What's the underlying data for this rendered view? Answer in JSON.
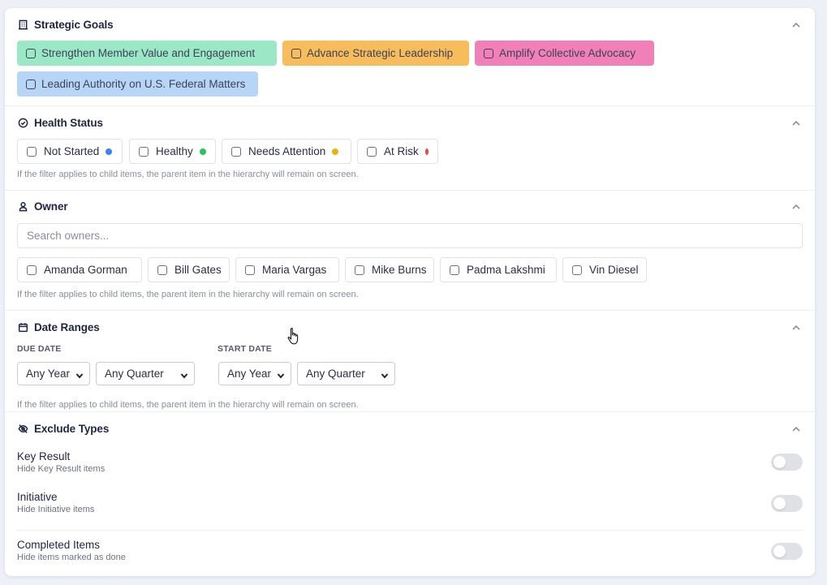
{
  "strategic_goals": {
    "title": "Strategic Goals",
    "icon": "building-icon",
    "goals": [
      {
        "label": "Strengthen Member Value and Engagement",
        "color": "#9be8c7"
      },
      {
        "label": "Advance Strategic Leadership",
        "color": "#f7bd5c"
      },
      {
        "label": "Amplify Collective Advocacy",
        "color": "#f17fb8"
      },
      {
        "label": "Leading Authority on U.S. Federal Matters",
        "color": "#b7d6f7"
      }
    ]
  },
  "health_status": {
    "title": "Health Status",
    "icon": "check-circle-icon",
    "options": [
      {
        "label": "Not Started",
        "color": "#3b82f6"
      },
      {
        "label": "Healthy",
        "color": "#22c55e"
      },
      {
        "label": "Needs Attention",
        "color": "#eab308"
      },
      {
        "label": "At Risk",
        "color": "#ef4444"
      }
    ],
    "hint": "If the filter applies to child items, the parent item in the hierarchy will remain on screen."
  },
  "owner": {
    "title": "Owner",
    "icon": "user-icon",
    "search_placeholder": "Search owners...",
    "owners": [
      "Amanda Gorman",
      "Bill Gates",
      "Maria Vargas",
      "Mike Burns",
      "Padma Lakshmi",
      "Vin Diesel"
    ],
    "hint": "If the filter applies to child items, the parent item in the hierarchy will remain on screen."
  },
  "date_ranges": {
    "title": "Date Ranges",
    "icon": "calendar-icon",
    "due_date_label": "DUE DATE",
    "start_date_label": "START DATE",
    "due_year": "Any Year",
    "due_quarter": "Any Quarter",
    "start_year": "Any Year",
    "start_quarter": "Any Quarter",
    "hint": "If the filter applies to child items, the parent item in the hierarchy will remain on screen."
  },
  "exclude_types": {
    "title": "Exclude Types",
    "icon": "eye-off-icon",
    "items": [
      {
        "title": "Key Result",
        "subtitle": "Hide Key Result items"
      },
      {
        "title": "Initiative",
        "subtitle": "Hide Initiative items"
      },
      {
        "title": "Completed Items",
        "subtitle": "Hide items marked as done"
      }
    ]
  }
}
